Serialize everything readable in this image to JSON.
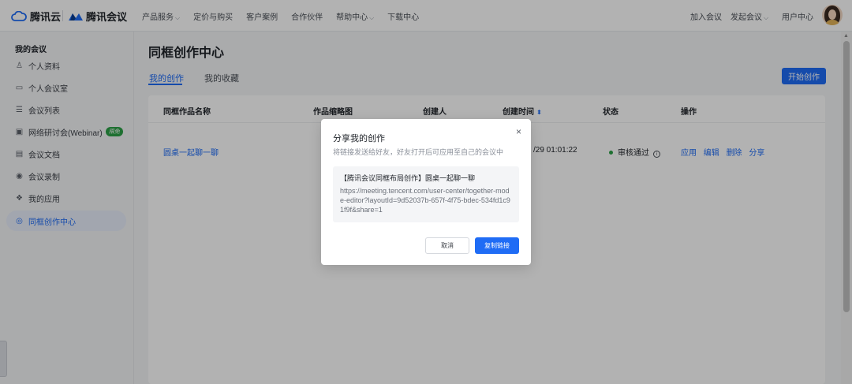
{
  "topnav": {
    "brand_cloud": "腾讯云",
    "brand_meeting": "腾讯会议",
    "items": [
      {
        "label": "产品服务",
        "has_caret": true
      },
      {
        "label": "定价与购买",
        "has_caret": false
      },
      {
        "label": "客户案例",
        "has_caret": false
      },
      {
        "label": "合作伙伴",
        "has_caret": false
      },
      {
        "label": "帮助中心",
        "has_caret": true
      },
      {
        "label": "下载中心",
        "has_caret": false
      }
    ],
    "join_meeting": "加入会议",
    "start_meeting": "发起会议",
    "user_center": "用户中心",
    "caret": "⌵"
  },
  "sidebar": {
    "heading": "我的会议",
    "items": [
      {
        "label": "个人资料",
        "icon": "user-icon",
        "glyph": "♙"
      },
      {
        "label": "个人会议室",
        "icon": "room-icon",
        "glyph": "▭"
      },
      {
        "label": "会议列表",
        "icon": "list-icon",
        "glyph": "☰"
      },
      {
        "label": "网络研讨会(Webinar)",
        "icon": "webinar-icon",
        "glyph": "▣",
        "badge": "限免"
      },
      {
        "label": "会议文档",
        "icon": "document-icon",
        "glyph": "▤"
      },
      {
        "label": "会议录制",
        "icon": "record-icon",
        "glyph": "◉"
      },
      {
        "label": "我的应用",
        "icon": "apps-icon",
        "glyph": "❖"
      },
      {
        "label": "同框创作中心",
        "icon": "creation-icon",
        "glyph": "◎",
        "active": true
      }
    ]
  },
  "main": {
    "title": "同框创作中心",
    "tabs": [
      {
        "label": "我的创作",
        "active": true
      },
      {
        "label": "我的收藏",
        "active": false
      }
    ],
    "start_button": "开始创作",
    "table": {
      "headers": [
        "同框作品名称",
        "作品缩略图",
        "创建人",
        "创建时间",
        "状态",
        "操作"
      ],
      "sort_glyph": "⬍",
      "rows": [
        {
          "name": "圆桌一起聊一聊",
          "created_time": "/29 01:01:22",
          "status": "审核通过",
          "actions": [
            "应用",
            "编辑",
            "删除",
            "分享"
          ]
        }
      ]
    }
  },
  "modal": {
    "title": "分享我的创作",
    "description": "将链接发送给好友，好友打开后可应用至自己的会议中",
    "link_title": "【腾讯会议同框布局创作】圆桌一起聊一聊",
    "link_url": "https://meeting.tencent.com/user-center/together-mode-editor?layoutId=9d52037b-657f-4f75-bdec-534fd1c91f9f&share=1",
    "cancel": "取消",
    "copy": "复制链接",
    "close_glyph": "×"
  },
  "colors": {
    "accent": "#1f6cf5",
    "success": "#2ba147",
    "overlay": "rgba(0,0,0,0.30)"
  }
}
